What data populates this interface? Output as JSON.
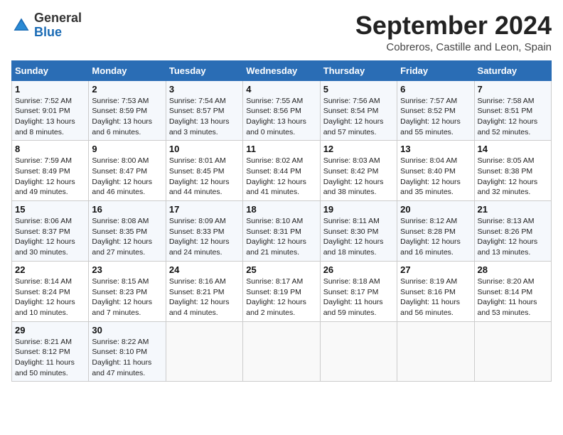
{
  "header": {
    "logo_general": "General",
    "logo_blue": "Blue",
    "month_title": "September 2024",
    "location": "Cobreros, Castille and Leon, Spain"
  },
  "calendar": {
    "days_of_week": [
      "Sunday",
      "Monday",
      "Tuesday",
      "Wednesday",
      "Thursday",
      "Friday",
      "Saturday"
    ],
    "weeks": [
      [
        {
          "day": "",
          "sunrise": "",
          "sunset": "",
          "daylight": ""
        },
        {
          "day": "2",
          "sunrise": "Sunrise: 7:53 AM",
          "sunset": "Sunset: 8:59 PM",
          "daylight": "Daylight: 13 hours and 6 minutes."
        },
        {
          "day": "3",
          "sunrise": "Sunrise: 7:54 AM",
          "sunset": "Sunset: 8:57 PM",
          "daylight": "Daylight: 13 hours and 3 minutes."
        },
        {
          "day": "4",
          "sunrise": "Sunrise: 7:55 AM",
          "sunset": "Sunset: 8:56 PM",
          "daylight": "Daylight: 13 hours and 0 minutes."
        },
        {
          "day": "5",
          "sunrise": "Sunrise: 7:56 AM",
          "sunset": "Sunset: 8:54 PM",
          "daylight": "Daylight: 12 hours and 57 minutes."
        },
        {
          "day": "6",
          "sunrise": "Sunrise: 7:57 AM",
          "sunset": "Sunset: 8:52 PM",
          "daylight": "Daylight: 12 hours and 55 minutes."
        },
        {
          "day": "7",
          "sunrise": "Sunrise: 7:58 AM",
          "sunset": "Sunset: 8:51 PM",
          "daylight": "Daylight: 12 hours and 52 minutes."
        }
      ],
      [
        {
          "day": "8",
          "sunrise": "Sunrise: 7:59 AM",
          "sunset": "Sunset: 8:49 PM",
          "daylight": "Daylight: 12 hours and 49 minutes."
        },
        {
          "day": "9",
          "sunrise": "Sunrise: 8:00 AM",
          "sunset": "Sunset: 8:47 PM",
          "daylight": "Daylight: 12 hours and 46 minutes."
        },
        {
          "day": "10",
          "sunrise": "Sunrise: 8:01 AM",
          "sunset": "Sunset: 8:45 PM",
          "daylight": "Daylight: 12 hours and 44 minutes."
        },
        {
          "day": "11",
          "sunrise": "Sunrise: 8:02 AM",
          "sunset": "Sunset: 8:44 PM",
          "daylight": "Daylight: 12 hours and 41 minutes."
        },
        {
          "day": "12",
          "sunrise": "Sunrise: 8:03 AM",
          "sunset": "Sunset: 8:42 PM",
          "daylight": "Daylight: 12 hours and 38 minutes."
        },
        {
          "day": "13",
          "sunrise": "Sunrise: 8:04 AM",
          "sunset": "Sunset: 8:40 PM",
          "daylight": "Daylight: 12 hours and 35 minutes."
        },
        {
          "day": "14",
          "sunrise": "Sunrise: 8:05 AM",
          "sunset": "Sunset: 8:38 PM",
          "daylight": "Daylight: 12 hours and 32 minutes."
        }
      ],
      [
        {
          "day": "15",
          "sunrise": "Sunrise: 8:06 AM",
          "sunset": "Sunset: 8:37 PM",
          "daylight": "Daylight: 12 hours and 30 minutes."
        },
        {
          "day": "16",
          "sunrise": "Sunrise: 8:08 AM",
          "sunset": "Sunset: 8:35 PM",
          "daylight": "Daylight: 12 hours and 27 minutes."
        },
        {
          "day": "17",
          "sunrise": "Sunrise: 8:09 AM",
          "sunset": "Sunset: 8:33 PM",
          "daylight": "Daylight: 12 hours and 24 minutes."
        },
        {
          "day": "18",
          "sunrise": "Sunrise: 8:10 AM",
          "sunset": "Sunset: 8:31 PM",
          "daylight": "Daylight: 12 hours and 21 minutes."
        },
        {
          "day": "19",
          "sunrise": "Sunrise: 8:11 AM",
          "sunset": "Sunset: 8:30 PM",
          "daylight": "Daylight: 12 hours and 18 minutes."
        },
        {
          "day": "20",
          "sunrise": "Sunrise: 8:12 AM",
          "sunset": "Sunset: 8:28 PM",
          "daylight": "Daylight: 12 hours and 16 minutes."
        },
        {
          "day": "21",
          "sunrise": "Sunrise: 8:13 AM",
          "sunset": "Sunset: 8:26 PM",
          "daylight": "Daylight: 12 hours and 13 minutes."
        }
      ],
      [
        {
          "day": "22",
          "sunrise": "Sunrise: 8:14 AM",
          "sunset": "Sunset: 8:24 PM",
          "daylight": "Daylight: 12 hours and 10 minutes."
        },
        {
          "day": "23",
          "sunrise": "Sunrise: 8:15 AM",
          "sunset": "Sunset: 8:23 PM",
          "daylight": "Daylight: 12 hours and 7 minutes."
        },
        {
          "day": "24",
          "sunrise": "Sunrise: 8:16 AM",
          "sunset": "Sunset: 8:21 PM",
          "daylight": "Daylight: 12 hours and 4 minutes."
        },
        {
          "day": "25",
          "sunrise": "Sunrise: 8:17 AM",
          "sunset": "Sunset: 8:19 PM",
          "daylight": "Daylight: 12 hours and 2 minutes."
        },
        {
          "day": "26",
          "sunrise": "Sunrise: 8:18 AM",
          "sunset": "Sunset: 8:17 PM",
          "daylight": "Daylight: 11 hours and 59 minutes."
        },
        {
          "day": "27",
          "sunrise": "Sunrise: 8:19 AM",
          "sunset": "Sunset: 8:16 PM",
          "daylight": "Daylight: 11 hours and 56 minutes."
        },
        {
          "day": "28",
          "sunrise": "Sunrise: 8:20 AM",
          "sunset": "Sunset: 8:14 PM",
          "daylight": "Daylight: 11 hours and 53 minutes."
        }
      ],
      [
        {
          "day": "29",
          "sunrise": "Sunrise: 8:21 AM",
          "sunset": "Sunset: 8:12 PM",
          "daylight": "Daylight: 11 hours and 50 minutes."
        },
        {
          "day": "30",
          "sunrise": "Sunrise: 8:22 AM",
          "sunset": "Sunset: 8:10 PM",
          "daylight": "Daylight: 11 hours and 47 minutes."
        },
        {
          "day": "",
          "sunrise": "",
          "sunset": "",
          "daylight": ""
        },
        {
          "day": "",
          "sunrise": "",
          "sunset": "",
          "daylight": ""
        },
        {
          "day": "",
          "sunrise": "",
          "sunset": "",
          "daylight": ""
        },
        {
          "day": "",
          "sunrise": "",
          "sunset": "",
          "daylight": ""
        },
        {
          "day": "",
          "sunrise": "",
          "sunset": "",
          "daylight": ""
        }
      ]
    ],
    "week1_day1": {
      "day": "1",
      "sunrise": "Sunrise: 7:52 AM",
      "sunset": "Sunset: 9:01 PM",
      "daylight": "Daylight: 13 hours and 8 minutes."
    }
  }
}
